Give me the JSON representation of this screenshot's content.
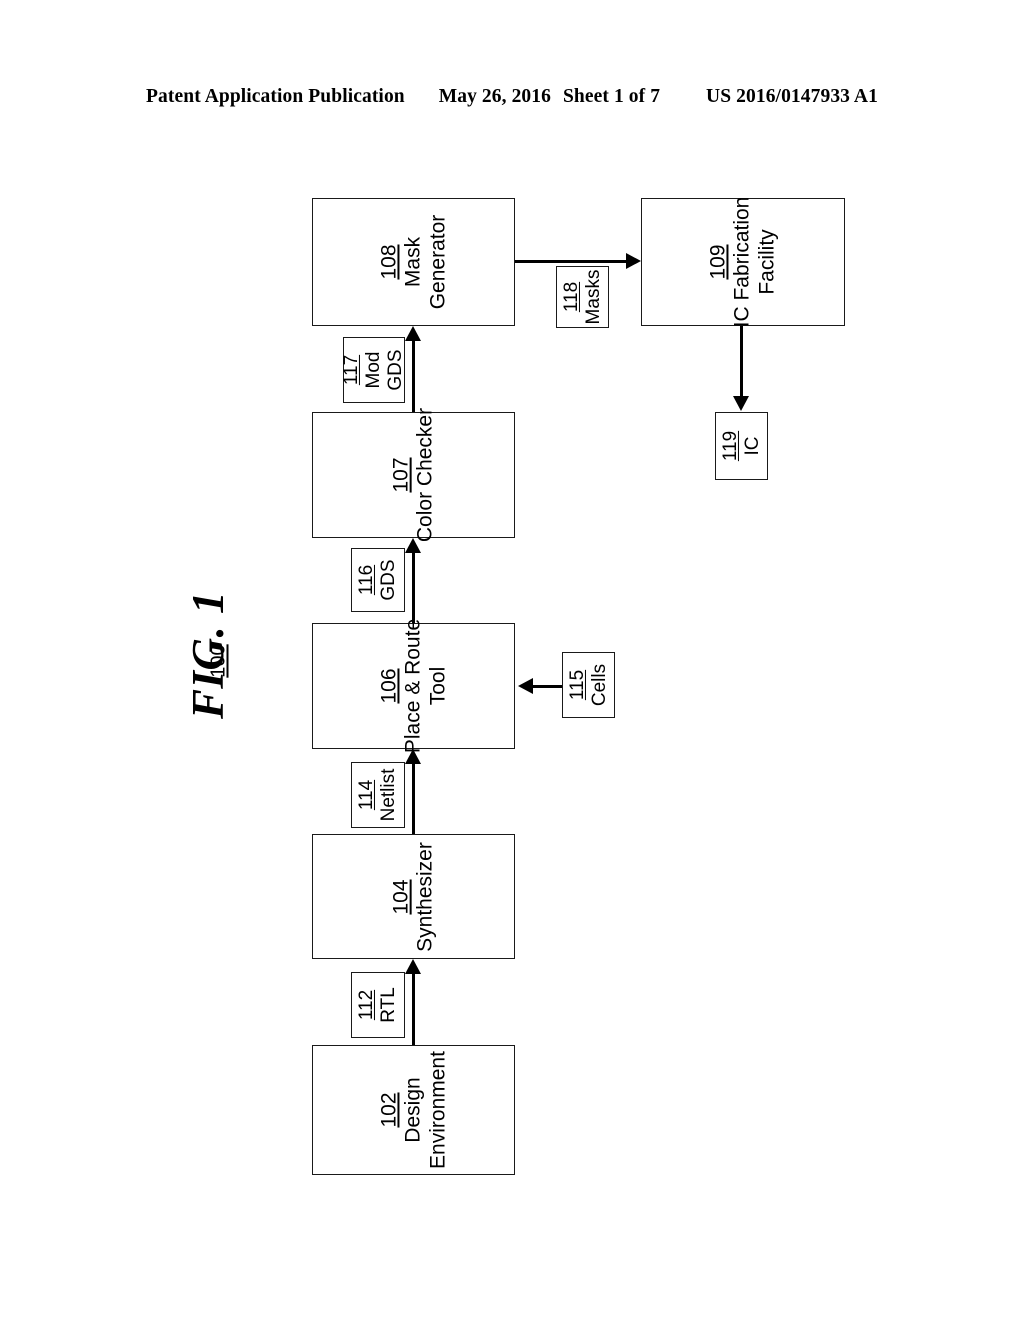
{
  "header": {
    "publication": "Patent Application Publication",
    "date": "May 26, 2016",
    "sheet": "Sheet 1 of 7",
    "patent_number": "US 2016/0147933 A1"
  },
  "figure": {
    "label": "FIG. 1",
    "number": "100"
  },
  "blocks": [
    {
      "ref": "102",
      "name": "Design\nEnvironment",
      "name_line1": "Design",
      "name_line2": "Environment"
    },
    {
      "ref": "104",
      "name": "Synthesizer",
      "name_line1": "Synthesizer",
      "name_line2": ""
    },
    {
      "ref": "106",
      "name": "Place & Route Tool",
      "name_line1": "Place & Route",
      "name_line2": "Tool"
    },
    {
      "ref": "107",
      "name": "Color Checker",
      "name_line1": "Color Checker",
      "name_line2": ""
    },
    {
      "ref": "108",
      "name": "Mask Generator",
      "name_line1": "Mask",
      "name_line2": "Generator"
    },
    {
      "ref": "109",
      "name": "IC Fabrication Facility",
      "name_line1": "IC Fabrication",
      "name_line2": "Facility"
    }
  ],
  "chips": [
    {
      "ref": "112",
      "name": "RTL",
      "name_line1": "RTL",
      "name_line2": ""
    },
    {
      "ref": "114",
      "name": "Netlist",
      "name_line1": "Netlist",
      "name_line2": ""
    },
    {
      "ref": "115",
      "name": "Cells",
      "name_line1": "Cells",
      "name_line2": ""
    },
    {
      "ref": "116",
      "name": "GDS",
      "name_line1": "GDS",
      "name_line2": ""
    },
    {
      "ref": "117",
      "name": "Mod GDS",
      "name_line1": "Mod",
      "name_line2": "GDS"
    },
    {
      "ref": "118",
      "name": "Masks",
      "name_line1": "Masks",
      "name_line2": ""
    },
    {
      "ref": "119",
      "name": "IC",
      "name_line1": "IC",
      "name_line2": ""
    }
  ],
  "colors": {
    "ink": "#000000",
    "paper": "#ffffff"
  }
}
